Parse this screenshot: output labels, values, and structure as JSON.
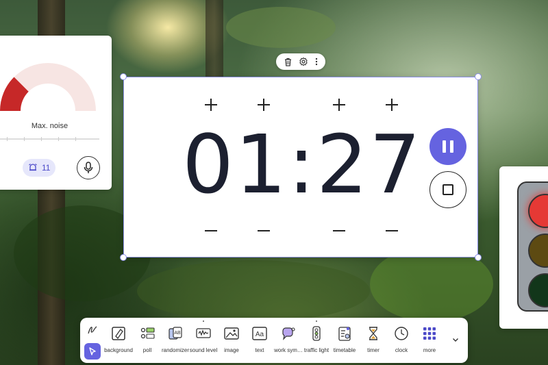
{
  "noise_meter": {
    "label": "Max. noise",
    "alarm_count": "11",
    "level_fraction": 0.25,
    "colors": {
      "active": "#c62828",
      "inactive": "#f7e5e3",
      "accent": "#6563e0"
    },
    "icons": {
      "alarm": "alarm-bell-icon",
      "mic": "microphone-icon"
    }
  },
  "timer": {
    "display": "01:27",
    "toolbar_icons": [
      "trash-icon",
      "gear-icon",
      "more-vertical-icon"
    ],
    "pause_label": "pause",
    "stop_label": "stop",
    "colors": {
      "accent": "#6563e0",
      "selection": "#8a8ee8",
      "digits": "#1c2030"
    }
  },
  "traffic_light": {
    "lights": [
      {
        "name": "red",
        "color": "#e53935",
        "active": true
      },
      {
        "name": "yellow",
        "color": "#5d4a12",
        "active": false
      },
      {
        "name": "green",
        "color": "#12361a",
        "active": false
      }
    ]
  },
  "toolbar": {
    "tools": [
      {
        "id": "background",
        "label": "background",
        "icon": "background-icon"
      },
      {
        "id": "poll",
        "label": "poll",
        "icon": "poll-icon"
      },
      {
        "id": "randomizer",
        "label": "randomizer",
        "icon": "randomizer-icon"
      },
      {
        "id": "sound-level",
        "label": "sound level",
        "icon": "sound-level-icon"
      },
      {
        "id": "image",
        "label": "image",
        "icon": "image-icon"
      },
      {
        "id": "text",
        "label": "text",
        "icon": "text-icon"
      },
      {
        "id": "work-symbols",
        "label": "work sym…",
        "icon": "work-symbols-icon"
      },
      {
        "id": "traffic-light",
        "label": "traffic light",
        "icon": "traffic-light-icon"
      },
      {
        "id": "timetable",
        "label": "timetable",
        "icon": "timetable-icon"
      },
      {
        "id": "timer",
        "label": "timer",
        "icon": "hourglass-icon"
      },
      {
        "id": "clock",
        "label": "clock",
        "icon": "clock-icon"
      },
      {
        "id": "more",
        "label": "more",
        "icon": "grid-icon"
      }
    ],
    "colors": {
      "accent": "#6563e0"
    }
  }
}
